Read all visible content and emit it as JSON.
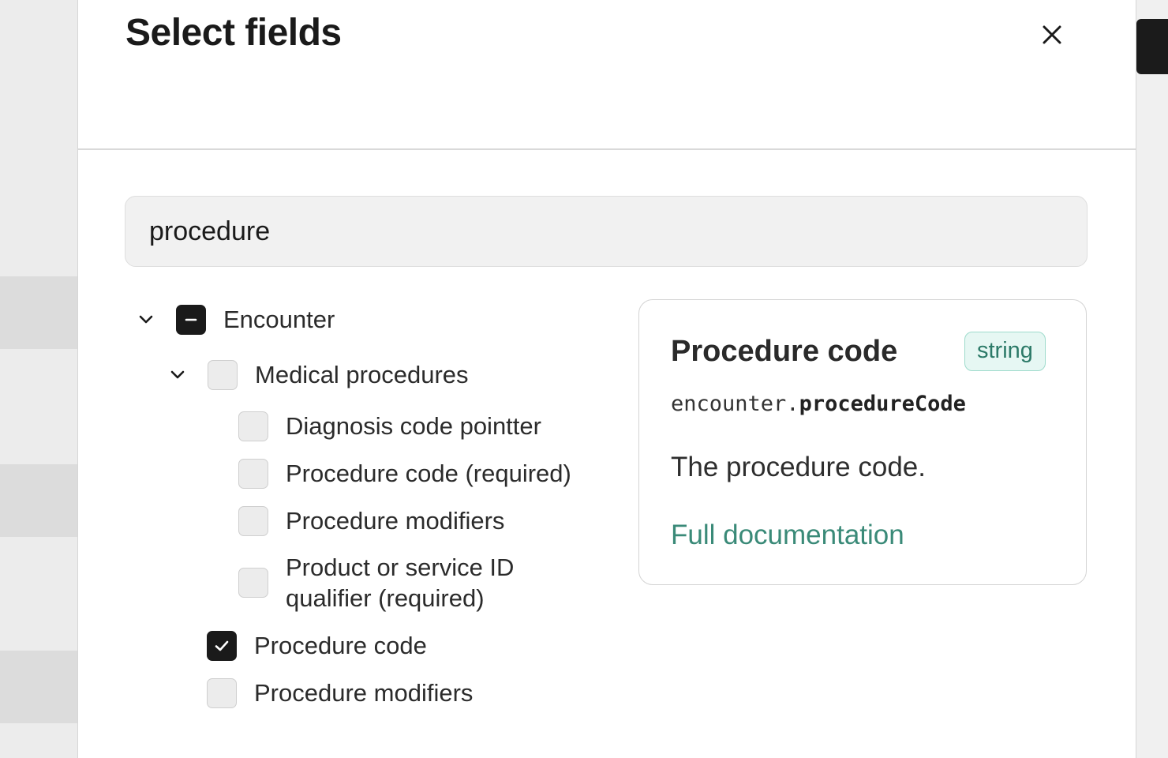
{
  "modal": {
    "title": "Select fields",
    "close_icon": "close-icon"
  },
  "search": {
    "value": "procedure"
  },
  "tree": {
    "encounter": {
      "label": "Encounter",
      "state": "indeterminate"
    },
    "medical_procedures": {
      "label": "Medical procedures",
      "state": "unchecked"
    },
    "items": [
      {
        "label": "Diagnosis code pointter",
        "state": "unchecked"
      },
      {
        "label": "Procedure code (required)",
        "state": "unchecked"
      },
      {
        "label": "Procedure modifiers",
        "state": "unchecked"
      },
      {
        "label_line1": "Product or service ID",
        "label_line2": "qualifier (required)",
        "state": "unchecked"
      }
    ],
    "procedure_code": {
      "label": "Procedure code",
      "state": "checked"
    },
    "procedure_modifiers": {
      "label": "Procedure modifiers",
      "state": "unchecked"
    }
  },
  "detail": {
    "title": "Procedure code",
    "type": "string",
    "path_prefix": "encounter.",
    "path_field": "procedureCode",
    "description": "The procedure code.",
    "link": "Full documentation"
  },
  "colors": {
    "accent": "#3a8a78",
    "badge_bg": "#e6f7f3",
    "checkbox_dark": "#1a1a1a"
  }
}
